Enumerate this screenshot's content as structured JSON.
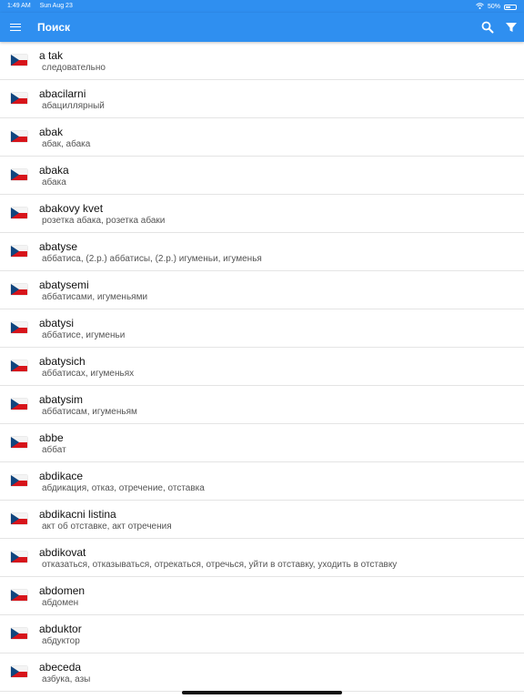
{
  "status_bar": {
    "time": "1:49 AM",
    "date": "Sun Aug 23",
    "battery_text": "50%",
    "battery_level": 0.5,
    "icons": [
      "wifi-icon",
      "battery-icon"
    ]
  },
  "app_bar": {
    "title": "Поиск",
    "background": "#2f8ff0",
    "icons": [
      "menu-icon",
      "search-icon",
      "filter-icon"
    ]
  },
  "flag_icon": "czech-flag-icon",
  "entries": [
    {
      "word": "a tak",
      "translation": "следовательно"
    },
    {
      "word": "abacilarni",
      "translation": "абациллярный"
    },
    {
      "word": "abak",
      "translation": "абак, абака"
    },
    {
      "word": "abaka",
      "translation": "абака"
    },
    {
      "word": "abakovy kvet",
      "translation": "розетка абака, розетка абаки"
    },
    {
      "word": "abatyse",
      "translation": "аббатиса, (2.р.) аббатисы, (2.р.) игуменьи, игуменья"
    },
    {
      "word": "abatysemi",
      "translation": "аббатисами, игуменьями"
    },
    {
      "word": "abatysi",
      "translation": "аббатисе, игуменьи"
    },
    {
      "word": "abatysich",
      "translation": "аббатисах, игуменьях"
    },
    {
      "word": "abatysim",
      "translation": "аббатисам, игуменьям"
    },
    {
      "word": "abbe",
      "translation": "аббат"
    },
    {
      "word": "abdikace",
      "translation": "абдикация, отказ, отречение, отставка"
    },
    {
      "word": "abdikacni listina",
      "translation": "акт об отставке, акт отречения"
    },
    {
      "word": "abdikovat",
      "translation": "отказаться, отказываться, отрекаться, отречься, уйти в отставку, уходить в отставку"
    },
    {
      "word": "abdomen",
      "translation": "абдомен"
    },
    {
      "word": "abduktor",
      "translation": "абдуктор"
    },
    {
      "word": "abeceda",
      "translation": "азбука, азы"
    }
  ]
}
